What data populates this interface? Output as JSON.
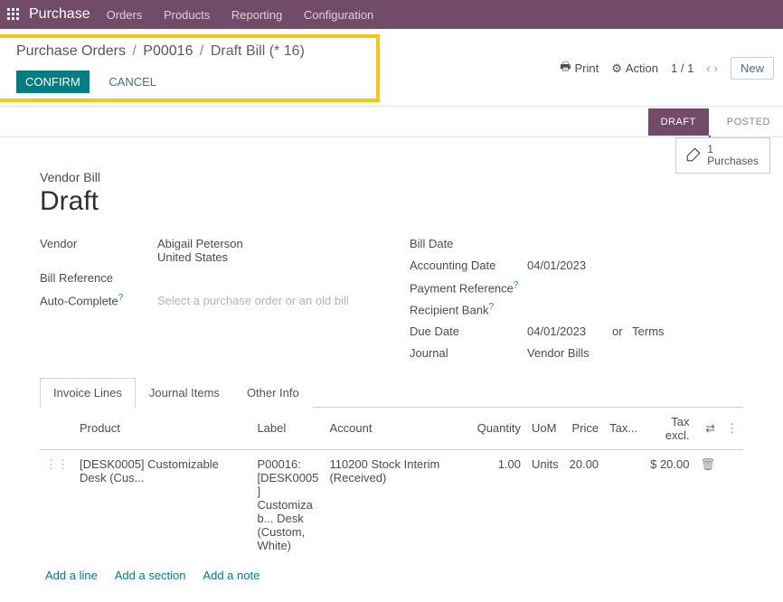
{
  "nav": {
    "app": "Purchase",
    "menu": [
      "Orders",
      "Products",
      "Reporting",
      "Configuration"
    ]
  },
  "breadcrumb": {
    "a": "Purchase Orders",
    "b": "P00016",
    "c": "Draft Bill (* 16)"
  },
  "buttons": {
    "confirm": "CONFIRM",
    "cancel": "CANCEL"
  },
  "ctrl": {
    "print": "Print",
    "action": "Action",
    "pager": "1 / 1",
    "new": "New"
  },
  "status": {
    "draft": "DRAFT",
    "posted": "POSTED"
  },
  "stat": {
    "count": "1",
    "label": "Purchases"
  },
  "form": {
    "subtitle": "Vendor Bill",
    "title": "Draft",
    "left": {
      "vendor_label": "Vendor",
      "vendor_name": "Abigail Peterson",
      "vendor_country": "United States",
      "billref_label": "Bill Reference",
      "autocomplete_label": "Auto-Complete",
      "autocomplete_ph": "Select a purchase order or an old bill"
    },
    "right": {
      "billdate_label": "Bill Date",
      "acctdate_label": "Accounting Date",
      "acctdate_val": "04/01/2023",
      "payref_label": "Payment Reference",
      "recbank_label": "Recipient Bank",
      "duedate_label": "Due Date",
      "duedate_val": "04/01/2023",
      "duedate_or": "or",
      "duedate_terms": "Terms",
      "journal_label": "Journal",
      "journal_val": "Vendor Bills"
    }
  },
  "tabs": {
    "a": "Invoice Lines",
    "b": "Journal Items",
    "c": "Other Info"
  },
  "table": {
    "h_product": "Product",
    "h_label": "Label",
    "h_account": "Account",
    "h_qty": "Quantity",
    "h_uom": "UoM",
    "h_price": "Price",
    "h_tax": "Tax...",
    "h_taxexcl": "Tax excl.",
    "row": {
      "product": "[DESK0005] Customizable Desk (Cus...",
      "label": "P00016: [DESK0005] Customizab... Desk (Custom, White)",
      "account": "110200 Stock Interim (Received)",
      "qty": "1.00",
      "uom": "Units",
      "price": "20.00",
      "taxexcl": "$ 20.00"
    },
    "footer": {
      "addline": "Add a line",
      "addsection": "Add a section",
      "addnote": "Add a note"
    }
  }
}
